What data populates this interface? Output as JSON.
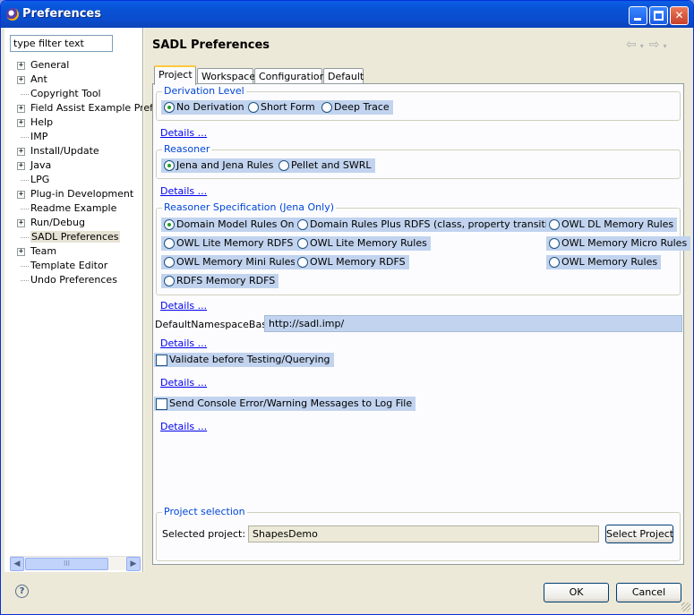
{
  "window": {
    "title": "Preferences"
  },
  "sidebar": {
    "filter_value": "type filter text",
    "items": [
      {
        "label": "General",
        "expandable": true
      },
      {
        "label": "Ant",
        "expandable": true
      },
      {
        "label": "Copyright Tool",
        "expandable": false
      },
      {
        "label": "Field Assist Example Pref",
        "expandable": true
      },
      {
        "label": "Help",
        "expandable": true
      },
      {
        "label": "IMP",
        "expandable": false
      },
      {
        "label": "Install/Update",
        "expandable": true
      },
      {
        "label": "Java",
        "expandable": true
      },
      {
        "label": "LPG",
        "expandable": false
      },
      {
        "label": "Plug-in Development",
        "expandable": true
      },
      {
        "label": "Readme Example",
        "expandable": false
      },
      {
        "label": "Run/Debug",
        "expandable": true
      },
      {
        "label": "SADL Preferences",
        "expandable": false,
        "selected": true
      },
      {
        "label": "Team",
        "expandable": true
      },
      {
        "label": "Template Editor",
        "expandable": false
      },
      {
        "label": "Undo Preferences",
        "expandable": false
      }
    ],
    "scrollbar_thumb": "III"
  },
  "page": {
    "title": "SADL Preferences",
    "tabs": [
      "Project",
      "Workspace",
      "Configuration",
      "Default"
    ],
    "active_tab": "Project",
    "derivation": {
      "label": "Derivation Level",
      "options": [
        "No Derivation",
        "Short Form",
        "Deep Trace"
      ],
      "selected": "No Derivation"
    },
    "reasoner": {
      "label": "Reasoner",
      "options": [
        "Jena and Jena Rules",
        "Pellet and SWRL"
      ],
      "selected": "Jena and Jena Rules"
    },
    "reasoner_spec": {
      "label": "Reasoner Specification (Jena Only)",
      "options": [
        "Domain Model Rules Only",
        "Domain Rules Plus RDFS (class, property transitivity)",
        "OWL DL Memory Rules",
        "OWL Lite Memory RDFS",
        "OWL Lite Memory Rules",
        "OWL Memory Micro Rules",
        "OWL Memory Mini Rules",
        "OWL Memory RDFS",
        "OWL Memory Rules",
        "RDFS Memory RDFS"
      ],
      "selected": "Domain Model Rules Only"
    },
    "details_link": "Details ...",
    "namespace": {
      "label": "DefaultNamespaceBase",
      "value": "http://sadl.imp/"
    },
    "validate_label": "Validate before Testing/Querying",
    "console_label": "Send Console Error/Warning Messages to Log File",
    "project_selection": {
      "label": "Project selection",
      "selected_label": "Selected project:",
      "selected_value": "ShapesDemo",
      "button": "Select Project"
    }
  },
  "footer": {
    "ok": "OK",
    "cancel": "Cancel"
  }
}
